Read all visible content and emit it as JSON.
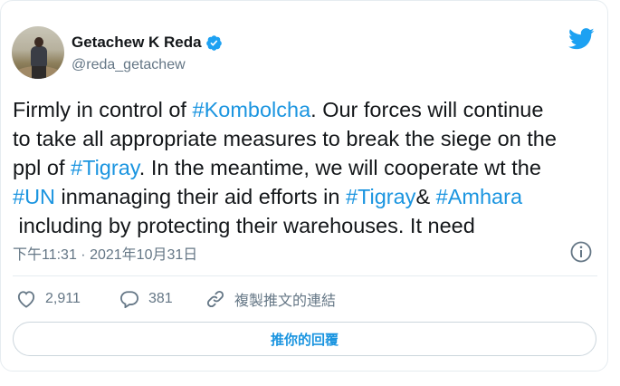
{
  "author": {
    "name": "Getachew K Reda",
    "handle": "@reda_getachew"
  },
  "tweet": {
    "segments": [
      {
        "text": "Firmly in control of ",
        "type": "text"
      },
      {
        "text": "#Kombolcha",
        "type": "hashtag"
      },
      {
        "text": ". Our forces will continue\nto take all appropriate measures to break the siege on the\nppl of ",
        "type": "text"
      },
      {
        "text": "#Tigray",
        "type": "hashtag"
      },
      {
        "text": ". In the meantime, we will cooperate wt the\n",
        "type": "text"
      },
      {
        "text": "#UN",
        "type": "hashtag"
      },
      {
        "text": " inmanaging their aid efforts in ",
        "type": "text"
      },
      {
        "text": "#Tigray",
        "type": "hashtag"
      },
      {
        "text": "& ",
        "type": "text"
      },
      {
        "text": "#Amhara",
        "type": "hashtag"
      },
      {
        "text": "\n including by protecting their warehouses. It need",
        "type": "text"
      }
    ],
    "timestamp": "下午11:31 · 2021年10月31日"
  },
  "actions": {
    "likes": "2,911",
    "replies": "381",
    "share_label": "複製推文的連結"
  },
  "reply_prompt": "推你的回覆",
  "colors": {
    "accent": "#1b95e0",
    "text": "#14171a",
    "muted": "#657786",
    "border": "#e6ecf0"
  },
  "icons": [
    "avatar",
    "verified-badge-icon",
    "twitter-bird-icon",
    "info-icon",
    "heart-icon",
    "reply-bubble-icon",
    "link-icon"
  ]
}
